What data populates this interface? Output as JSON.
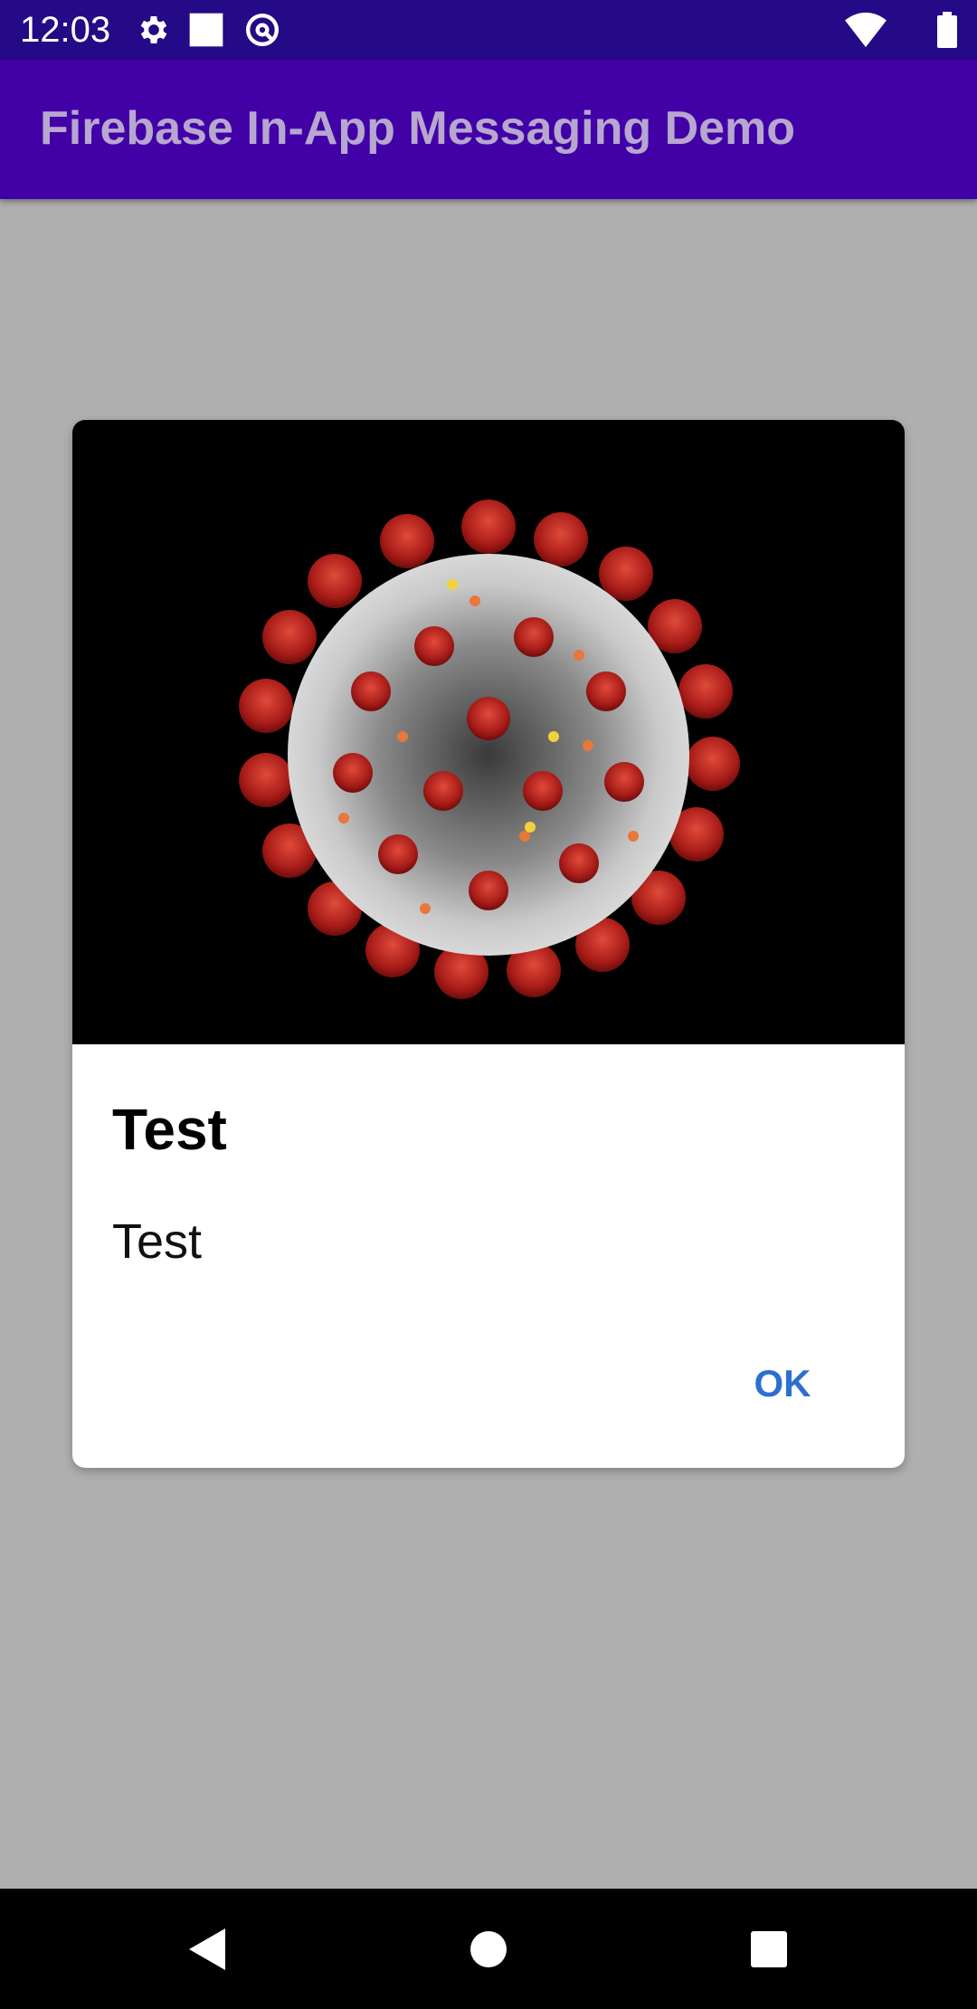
{
  "status_bar": {
    "time": "12:03",
    "icons_left": [
      "gear-icon",
      "square-notification-icon",
      "at-sign-icon"
    ],
    "icons_right": [
      "wifi-icon",
      "battery-icon"
    ]
  },
  "app_bar": {
    "title": "Firebase In-App Messaging Demo"
  },
  "dialog": {
    "image_icon": "coronavirus-illustration",
    "title": "Test",
    "body": "Test",
    "ok_label": "OK"
  },
  "nav_bar": {
    "buttons": [
      "back-icon",
      "home-icon",
      "recents-icon"
    ]
  },
  "colors": {
    "status_bar": "#240a86",
    "app_bar": "#4201a7",
    "app_title": "#b7a7cf",
    "scrim_background": "#afafaf",
    "dialog_image_background": "#000000",
    "ok_button": "#2c6fd1"
  }
}
